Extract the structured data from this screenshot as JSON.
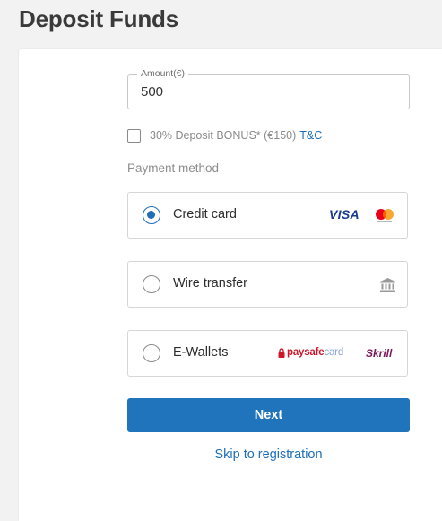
{
  "page": {
    "title": "Deposit Funds"
  },
  "amount": {
    "label": "Amount(€)",
    "value": "500"
  },
  "bonus": {
    "text": "30% Deposit BONUS* (€150)",
    "link": "T&C",
    "checked": false
  },
  "payment": {
    "heading": "Payment method",
    "options": [
      {
        "label": "Credit card",
        "selected": true,
        "icons": [
          "visa-logo",
          "mastercard-logo"
        ],
        "visa_text": "VISA"
      },
      {
        "label": "Wire transfer",
        "selected": false,
        "icons": [
          "bank-icon"
        ]
      },
      {
        "label": "E-Wallets",
        "selected": false,
        "icons": [
          "paysafecard-logo",
          "skrill-logo"
        ],
        "paysafe_text": "paysafe",
        "paysafe_card_text": "card",
        "skrill_text": "Skrill"
      }
    ]
  },
  "actions": {
    "next_label": "Next",
    "skip_label": "Skip to registration"
  },
  "colors": {
    "accent": "#1f74bc",
    "link": "#1e6fb8",
    "visa": "#1a3a8f",
    "paysafe": "#d0152a",
    "skrill": "#7b1a5a"
  }
}
